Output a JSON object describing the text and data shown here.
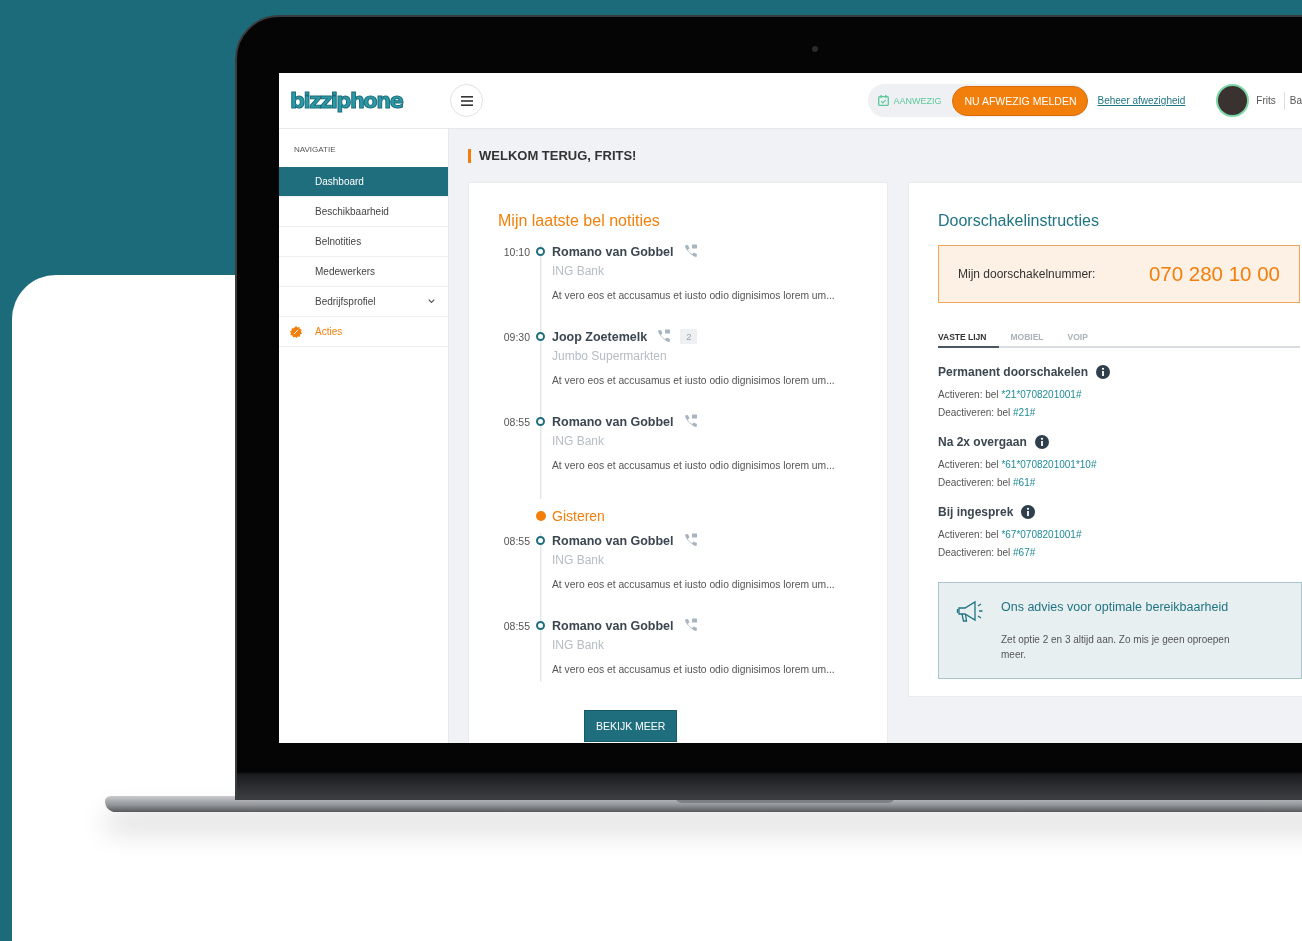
{
  "header": {
    "logo": "bizziphone",
    "status": "AANWEZIG",
    "absent_button": "NU AFWEZIG MELDEN",
    "manage_link": "Beheer afwezigheid",
    "user_name": "Frits",
    "cut_text": "Ba"
  },
  "sidebar": {
    "heading": "NAVIGATIE",
    "items": [
      {
        "label": "Dashboard",
        "kind": "link",
        "selected": true
      },
      {
        "label": "Beschikbaarheid",
        "kind": "link",
        "selected": false
      },
      {
        "label": "Belnotities",
        "kind": "link",
        "selected": false
      },
      {
        "label": "Medewerkers",
        "kind": "link",
        "selected": false
      },
      {
        "label": "Bedrijfsprofiel",
        "kind": "submenu",
        "selected": false
      },
      {
        "label": "Acties",
        "kind": "promo",
        "selected": false
      }
    ]
  },
  "welcome": "WELKOM TERUG, FRITS!",
  "notes": {
    "title": "Mijn laatste bel notities",
    "entries": [
      {
        "kind": "call",
        "time": "10:10",
        "name": "Romano van Gobbel",
        "company": "ING Bank",
        "text": "At vero eos et accusamus et iusto odio dignisimos lorem um..."
      },
      {
        "kind": "call",
        "time": "09:30",
        "name": "Joop Zoetemelk",
        "count": "2",
        "company": "Jumbo Supermarkten",
        "text": "At vero eos et accusamus et iusto odio dignisimos lorem um..."
      },
      {
        "kind": "call",
        "time": "08:55",
        "name": "Romano van Gobbel",
        "company": "ING Bank",
        "text": "At vero eos et accusamus et iusto odio dignisimos lorem um..."
      },
      {
        "kind": "day",
        "label": "Gisteren"
      },
      {
        "kind": "call",
        "time": "08:55",
        "name": "Romano van Gobbel",
        "company": "ING Bank",
        "text": "At vero eos et accusamus et iusto odio dignisimos lorem um..."
      },
      {
        "kind": "call",
        "time": "08:55",
        "name": "Romano van Gobbel",
        "company": "ING Bank",
        "text": "At vero eos et accusamus et iusto odio dignisimos lorem um..."
      }
    ],
    "button": "BEKIJK MEER"
  },
  "forwarding": {
    "title": "Doorschakelinstructies",
    "number_label": "Mijn doorschakelnummer:",
    "number": "070 280 10 00",
    "tabs": [
      {
        "label": "VASTE LIJN",
        "selected": true
      },
      {
        "label": "MOBIEL",
        "selected": false
      },
      {
        "label": "VOIP",
        "selected": false
      }
    ],
    "sections": [
      {
        "title": "Permanent doorschakelen",
        "activate_label": "Activeren: bel",
        "activate_code": "*21*0708201001#",
        "deactivate_label": "Deactiveren: bel",
        "deactivate_code": "#21#"
      },
      {
        "title": "Na 2x overgaan",
        "activate_label": "Activeren: bel",
        "activate_code": "*61*0708201001*10#",
        "deactivate_label": "Deactiveren: bel",
        "deactivate_code": "#61#"
      },
      {
        "title": "Bij ingesprek",
        "activate_label": "Activeren: bel",
        "activate_code": "*67*0708201001#",
        "deactivate_label": "Deactiveren: bel",
        "deactivate_code": "#67#"
      }
    ],
    "advice": {
      "title": "Ons advies voor optimale bereikbaarheid",
      "text": "Zet optie 2 en 3 altijd aan. Zo mis je geen oproepen meer."
    }
  }
}
